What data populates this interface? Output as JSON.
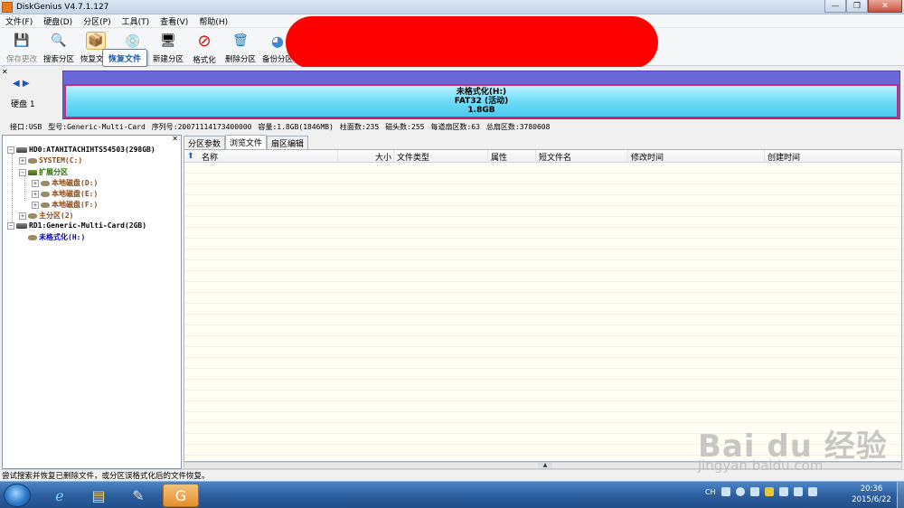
{
  "window": {
    "title": "DiskGenius V4.7.1.127",
    "buttons": [
      "—",
      "❐",
      "✕"
    ]
  },
  "menu": [
    "文件(F)",
    "硬盘(D)",
    "分区(P)",
    "工具(T)",
    "查看(V)",
    "帮助(H)"
  ],
  "toolbar": {
    "buttons": [
      {
        "label": "保存更改",
        "icon": "save-icon",
        "glyph": "💾"
      },
      {
        "label": "搜索分区",
        "icon": "search-icon",
        "glyph": "🔍"
      },
      {
        "label": "恢复文件",
        "icon": "recover-icon",
        "glyph": "📦"
      },
      {
        "label": "",
        "icon": "disk-cd-icon",
        "glyph": "💿"
      },
      {
        "label": "新建分区",
        "icon": "new-partition-icon",
        "glyph": "🖥"
      },
      {
        "label": "格式化",
        "icon": "format-icon",
        "glyph": "⊘"
      },
      {
        "label": "删除分区",
        "icon": "delete-icon",
        "glyph": "🗑"
      },
      {
        "label": "备份分区",
        "icon": "backup-icon",
        "glyph": "◕"
      }
    ],
    "tooltip": "恢复文件"
  },
  "diskmap": {
    "disk_label": "硬盘 1",
    "partition": {
      "name": "未格式化(H:)",
      "fs": "FAT32 (活动)",
      "size": "1.8GB"
    }
  },
  "info": {
    "interface": "接口:USB",
    "model": "型号:Generic-Multi-Card",
    "serial": "序列号:20071114173400000",
    "capacity": "容量:1.8GB(1846MB)",
    "cylinders": "柱面数:235",
    "heads": "磁头数:255",
    "sectors_per_track": "每道扇区数:63",
    "total_sectors": "总扇区数:3780608"
  },
  "tree": {
    "hd0": "HD0:ATAHITACHIHTS54503(298GB)",
    "system": "SYSTEM(C:)",
    "extended": "扩展分区",
    "d": "本地磁盘(D:)",
    "e": "本地磁盘(E:)",
    "f": "本地磁盘(F:)",
    "primary": "主分区(2)",
    "rd1": "RD1:Generic-Multi-Card(2GB)",
    "unformatted": "未格式化(H:)"
  },
  "tabs": [
    "分区参数",
    "浏览文件",
    "扇区编辑"
  ],
  "columns": [
    "名称",
    "大小",
    "文件类型",
    "属性",
    "短文件名",
    "修改时间",
    "创建时间"
  ],
  "status": "尝试搜索并恢复已删除文件，或分区误格式化后的文件恢复。",
  "taskbar": {
    "lang": "CH",
    "time": "20:36",
    "date": "2015/6/22"
  },
  "watermark": {
    "logo": "Bai du 经验",
    "url": "jingyan.baidu.com"
  }
}
